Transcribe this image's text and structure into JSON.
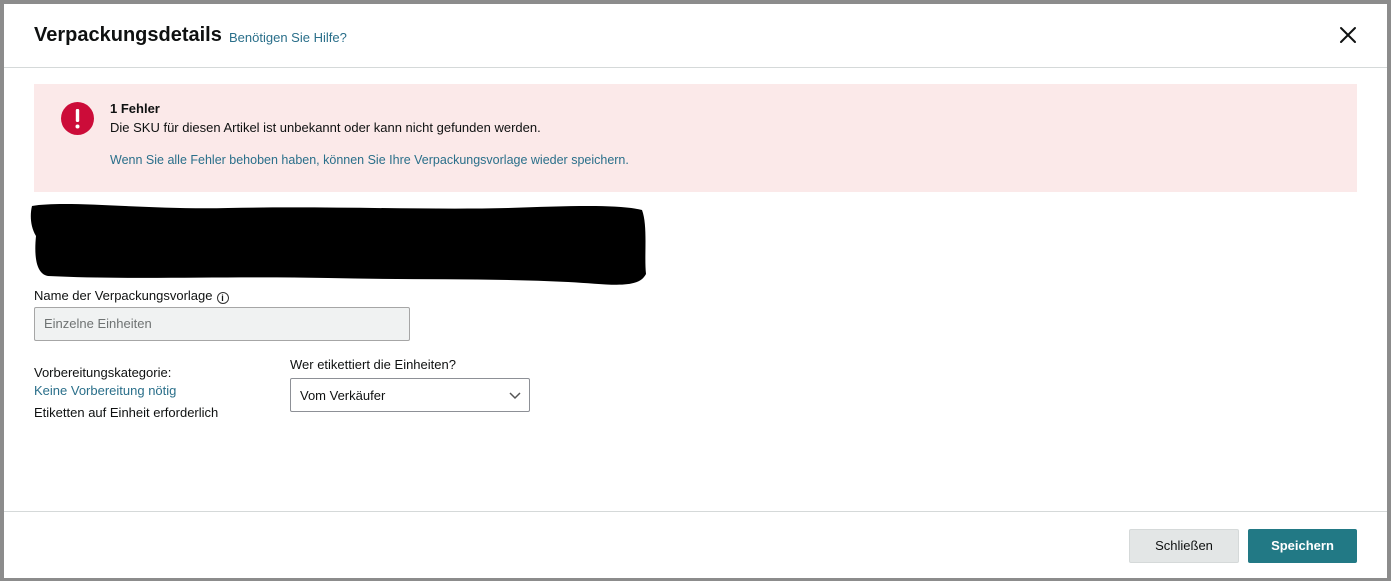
{
  "header": {
    "title": "Verpackungsdetails",
    "help_link": "Benötigen Sie Hilfe?"
  },
  "alert": {
    "icon": "error-exclamation-icon",
    "title": "1 Fehler",
    "message": "Die SKU für diesen Artikel ist unbekannt oder kann nicht gefunden werden.",
    "hint": "Wenn Sie alle Fehler behoben haben, können Sie Ihre Verpackungsvorlage wieder speichern."
  },
  "form": {
    "template_name_label": "Name der Verpackungsvorlage",
    "template_name_value": "Einzelne Einheiten",
    "prep_category_label": "Vorbereitungskategorie:",
    "prep_category_value": "Keine Vorbereitung nötig",
    "labels_required_text": "Etiketten auf Einheit erforderlich",
    "who_labels_label": "Wer etikettiert die Einheiten?",
    "who_labels_selected": "Vom Verkäufer"
  },
  "footer": {
    "close_label": "Schließen",
    "save_label": "Speichern"
  },
  "colors": {
    "accent": "#227985",
    "link": "#2a6f8a",
    "alert_bg": "#fbe9e9",
    "error_red": "#cc0c39"
  }
}
